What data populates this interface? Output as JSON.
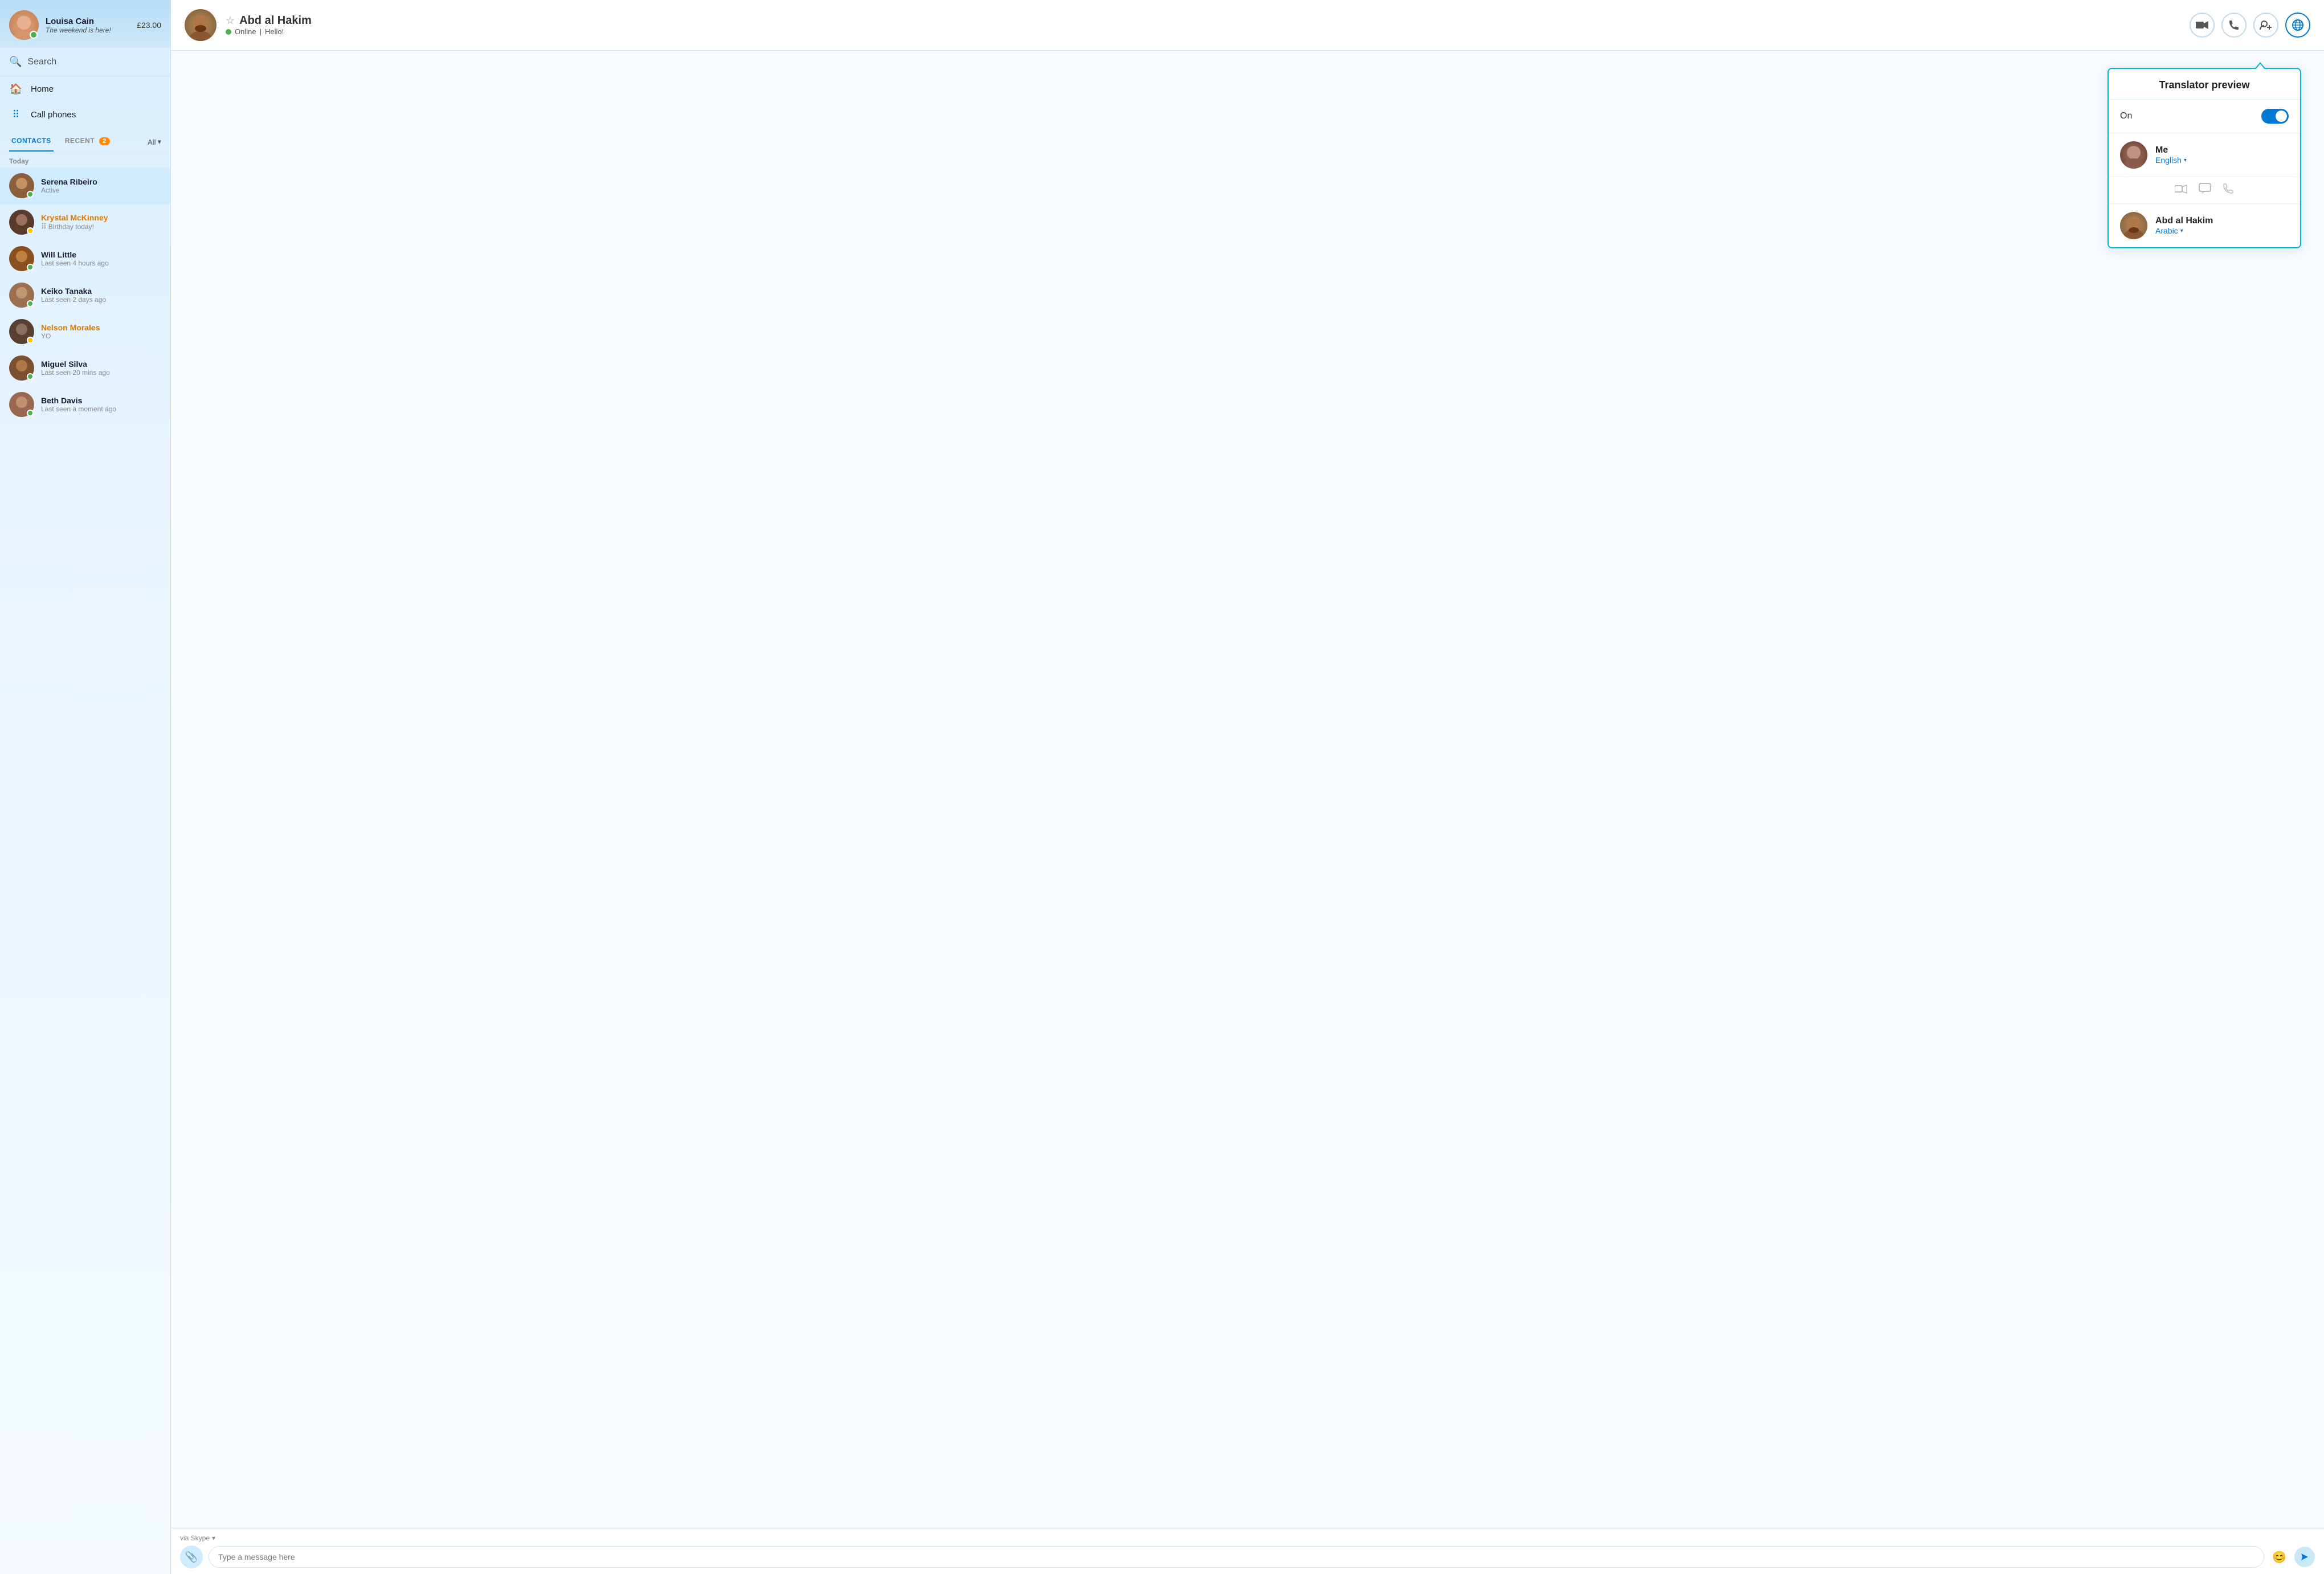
{
  "sidebar": {
    "user": {
      "name": "Louisa Cain",
      "status_text": "The weekend is here!",
      "credit": "£23.00",
      "status": "online"
    },
    "search": {
      "placeholder": "Search",
      "label": "Search"
    },
    "nav": [
      {
        "id": "home",
        "label": "Home",
        "icon": "🏠"
      },
      {
        "id": "call-phones",
        "label": "Call phones",
        "icon": "⠿"
      }
    ],
    "tabs": {
      "contacts_label": "CONTACTS",
      "recent_label": "RECENT",
      "recent_badge": "2",
      "all_label": "All"
    },
    "section_today": "Today",
    "contacts": [
      {
        "id": "serena",
        "name": "Serena Ribeiro",
        "sub": "Active",
        "status": "online",
        "selected": true,
        "name_color": "normal"
      },
      {
        "id": "krystal",
        "name": "Krystal McKinney",
        "sub": "Birthday today!",
        "status": "away",
        "selected": false,
        "name_color": "orange"
      },
      {
        "id": "will",
        "name": "Will Little",
        "sub": "Last seen 4 hours ago",
        "status": "online",
        "selected": false,
        "name_color": "normal"
      },
      {
        "id": "keiko",
        "name": "Keiko Tanaka",
        "sub": "Last seen 2 days ago",
        "status": "online",
        "selected": false,
        "name_color": "normal"
      },
      {
        "id": "nelson",
        "name": "Nelson Morales",
        "sub": "YO",
        "status": "away",
        "selected": false,
        "name_color": "orange"
      },
      {
        "id": "miguel",
        "name": "Miguel Silva",
        "sub": "Last seen 20 mins ago",
        "status": "online",
        "selected": false,
        "name_color": "normal"
      },
      {
        "id": "beth",
        "name": "Beth Davis",
        "sub": "Last seen a moment ago",
        "status": "online",
        "selected": false,
        "name_color": "normal"
      }
    ],
    "avatar_colors": {
      "serena": "#5a3a2a",
      "krystal": "#4a2a1a",
      "will": "#8a5a20",
      "keiko": "#9a7050",
      "nelson": "#5a4030",
      "miguel": "#7a5030",
      "beth": "#9a6850"
    }
  },
  "chat": {
    "contact_name": "Abd al Hakim",
    "contact_status": "Online",
    "contact_status_extra": "Hello!",
    "header_actions": {
      "video_label": "Video call",
      "call_label": "Call",
      "add_label": "Add contact",
      "translate_label": "Translator"
    }
  },
  "translator": {
    "title": "Translator preview",
    "toggle_label": "On",
    "toggle_on": true,
    "me": {
      "name": "Me",
      "language": "English",
      "language_label": "English"
    },
    "divider_icons": [
      "📹",
      "💬",
      "📞"
    ],
    "contact": {
      "name": "Abd al Hakim",
      "language": "Arabic",
      "language_label": "Arabic"
    }
  },
  "input": {
    "via_label": "via Skype",
    "placeholder": "Type a message here",
    "attach_icon": "📎",
    "emoji_icon": "😊",
    "send_icon": "➤"
  }
}
